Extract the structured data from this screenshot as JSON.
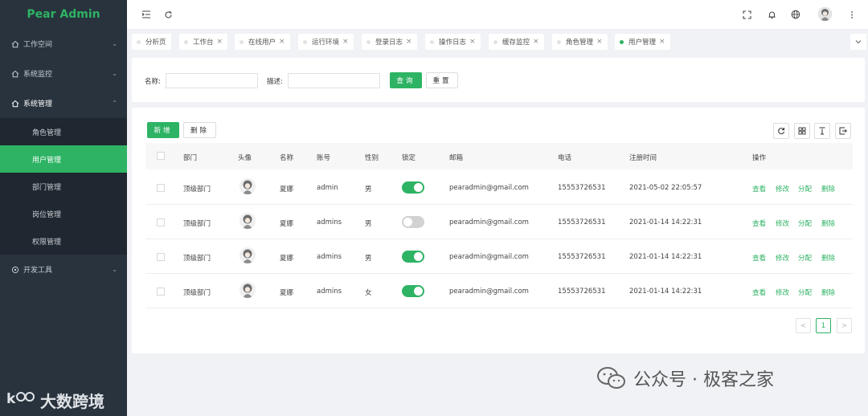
{
  "app": {
    "logo": "Pear Admin"
  },
  "sidebar": {
    "items": [
      {
        "label": "工作空间",
        "arrow": "⌄"
      },
      {
        "label": "系统监控",
        "arrow": "⌄"
      },
      {
        "label": "系统管理",
        "arrow": "⌃"
      },
      {
        "label": "开发工具",
        "arrow": "⌄"
      }
    ],
    "subitems": [
      {
        "label": "角色管理"
      },
      {
        "label": "用户管理"
      },
      {
        "label": "部门管理"
      },
      {
        "label": "岗位管理"
      },
      {
        "label": "权限管理"
      }
    ],
    "watermark": "大数跨境"
  },
  "tabs": [
    {
      "label": "分析页",
      "close": ""
    },
    {
      "label": "工作台",
      "close": "×"
    },
    {
      "label": "在线用户",
      "close": "×"
    },
    {
      "label": "运行环境",
      "close": "×"
    },
    {
      "label": "登录日志",
      "close": "×"
    },
    {
      "label": "操作日志",
      "close": "×"
    },
    {
      "label": "缓存监控",
      "close": "×"
    },
    {
      "label": "角色管理",
      "close": "×"
    },
    {
      "label": "用户管理",
      "close": "×"
    }
  ],
  "search": {
    "name_label": "名称:",
    "name_value": "",
    "desc_label": "描述:",
    "desc_value": "",
    "query_button": "查询",
    "reset_button": "重置"
  },
  "toolbar": {
    "add_button": "新增",
    "delete_button": "删除"
  },
  "table": {
    "headers": [
      "部门",
      "头像",
      "名称",
      "账号",
      "性别",
      "锁定",
      "邮箱",
      "电话",
      "注册时间",
      "操作"
    ],
    "rows": [
      {
        "dept": "顶级部门",
        "name": "夏娜",
        "account": "admin",
        "gender": "男",
        "locked": true,
        "email": "pearadmin@gmail.com",
        "phone": "15553726531",
        "created": "2021-05-02 22:05:57"
      },
      {
        "dept": "顶级部门",
        "name": "夏娜",
        "account": "admins",
        "gender": "男",
        "locked": false,
        "email": "pearadmin@gmail.com",
        "phone": "15553726531",
        "created": "2021-01-14 14:22:31"
      },
      {
        "dept": "顶级部门",
        "name": "夏娜",
        "account": "admins",
        "gender": "男",
        "locked": true,
        "email": "pearadmin@gmail.com",
        "phone": "15553726531",
        "created": "2021-01-14 14:22:31"
      },
      {
        "dept": "顶级部门",
        "name": "夏娜",
        "account": "admins",
        "gender": "女",
        "locked": true,
        "email": "pearadmin@gmail.com",
        "phone": "15553726531",
        "created": "2021-01-14 14:22:31"
      }
    ],
    "actions": {
      "view": "查看",
      "edit": "修改",
      "assign": "分配",
      "delete": "删除"
    }
  },
  "pagination": {
    "prev": "<",
    "current": "1",
    "next": ">"
  },
  "watermark_bottom": "公众号 · 极客之家",
  "colors": {
    "accent": "#2eb364",
    "sidebar_bg": "#28333e",
    "submenu_bg": "#1f2730"
  },
  "icons": [
    "menu-fold-icon",
    "refresh-icon",
    "fullscreen-icon",
    "bell-icon",
    "globe-icon",
    "more-vertical-icon",
    "home-icon",
    "settings-icon",
    "chevron-down-icon",
    "grid-icon",
    "export-icon",
    "print-icon"
  ]
}
